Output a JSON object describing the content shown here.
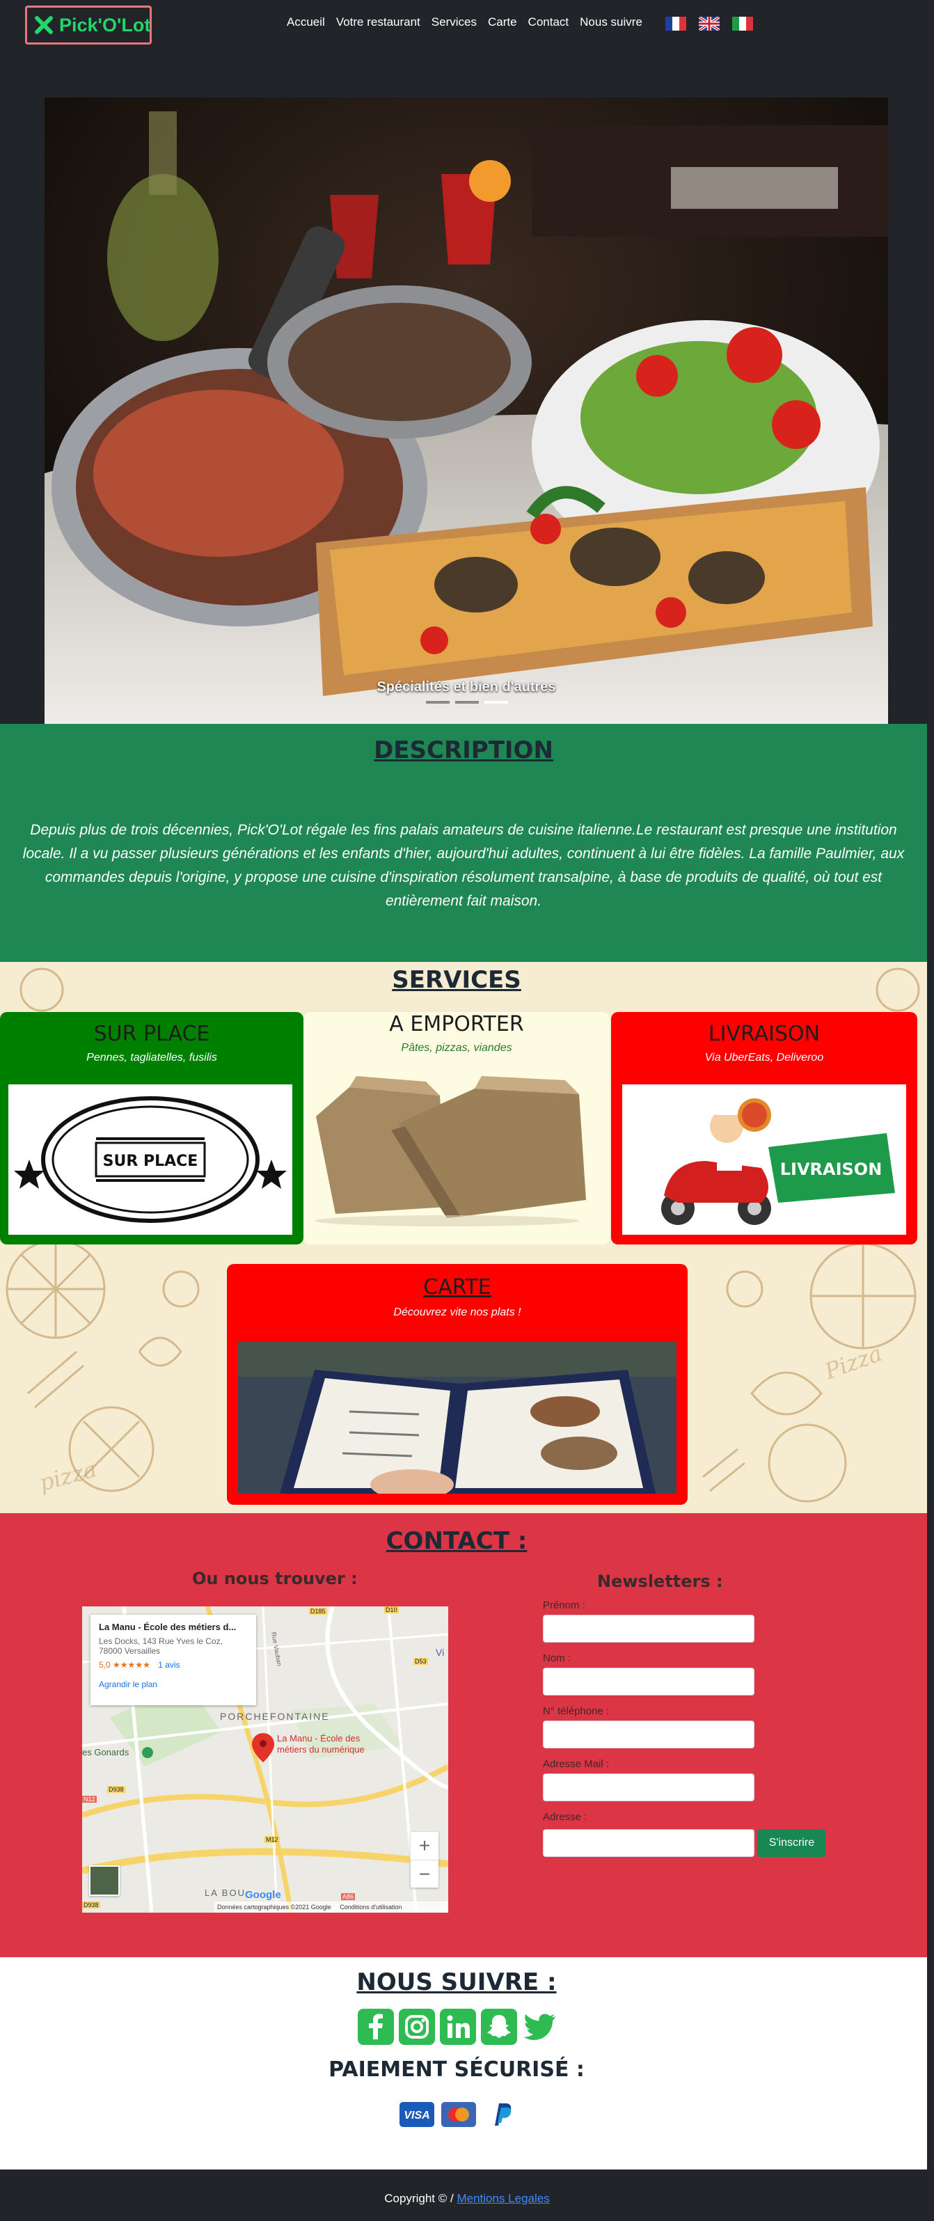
{
  "navbar": {
    "brand": "Pick'O'Lot",
    "links": [
      "Accueil",
      "Votre restaurant",
      "Services",
      "Carte",
      "Contact",
      "Nous suivre"
    ],
    "languages": [
      "french-flag-icon",
      "uk-flag-icon",
      "italian-flag-icon"
    ]
  },
  "carousel": {
    "caption": "Spécialités et bien d'autres",
    "slide_count": 3,
    "active_slide": 3
  },
  "description": {
    "title": "DESCRIPTION",
    "text": "Depuis plus de trois décennies, Pick'O'Lot régale les fins palais amateurs de cuisine italienne.Le restaurant est presque une institution locale. Il a vu passer plusieurs générations et les enfants d'hier, aujourd'hui adultes, continuent à lui être fidèles. La famille Paulmier, aux commandes depuis l'origine, y propose une cuisine d'inspiration résolument transalpine, à base de produits de qualité, où tout est entièrement fait maison."
  },
  "services": {
    "title": "SERVICES",
    "cards": [
      {
        "title": "SUR PLACE",
        "subtitle": "Pennes, tagliatelles, fusilis",
        "image_text": "SUR PLACE"
      },
      {
        "title": "A EMPORTER",
        "subtitle": "Pâtes, pizzas, viandes"
      },
      {
        "title": "LIVRAISON",
        "subtitle": "Via UberEats, Deliveroo",
        "image_text": "LIVRAISON"
      }
    ],
    "carte": {
      "title": "CARTE",
      "subtitle": "Découvrez vite nos plats !"
    }
  },
  "contact": {
    "title": "CONTACT :",
    "find_title": "Ou nous trouver :",
    "map": {
      "place_name": "La Manu - École des métiers d...",
      "address_line1": "Les Docks, 143 Rue Yves le Coz,",
      "address_line2": "78000 Versailles",
      "rating": "5,0",
      "stars": "★★★★★",
      "reviews": "1 avis",
      "enlarge": "Agrandir le plan",
      "district": "PORCHEFONTAINE",
      "pin_label_1": "La Manu - École des",
      "pin_label_2": "métiers du numérique",
      "area_left": "es Gonards",
      "area_bottom": "LA BOU",
      "road_1": "D185",
      "road_2": "D10",
      "road_3": "D53",
      "road_4": "D938",
      "road_5": "M12",
      "road_6": "A86",
      "road_7": "N12",
      "road_8": "D938",
      "street": "Rue Vauban",
      "corner_letter": "Vi",
      "zoom_in": "+",
      "zoom_out": "−",
      "google": "Google",
      "credits": "Données cartographiques ©2021 Google",
      "terms": "Conditions d'utilisation"
    },
    "newsletter": {
      "title": "Newsletters :",
      "fields": [
        "Prénom :",
        "Nom :",
        "N° téléphone :",
        "Adresse Mail :",
        "Adresse :"
      ],
      "submit": "S'inscrire"
    }
  },
  "follow": {
    "title": "NOUS SUIVRE :",
    "socials": [
      "facebook-icon",
      "instagram-icon",
      "linkedin-icon",
      "snapchat-icon",
      "twitter-icon"
    ],
    "payment_title": "PAIEMENT SÉCURISÉ :",
    "payments": [
      "visa-icon",
      "mastercard-icon",
      "paypal-icon"
    ]
  },
  "footer": {
    "copyright": "Copyright © / ",
    "legal_link": "Mentions Legales"
  },
  "colors": {
    "brand_green": "#22d667",
    "description_bg": "#1e8754",
    "contact_bg": "#dc3545",
    "card_green": "#008000",
    "card_red": "#ff0000",
    "submit_green": "#198754",
    "social_green": "#2ebc52"
  }
}
